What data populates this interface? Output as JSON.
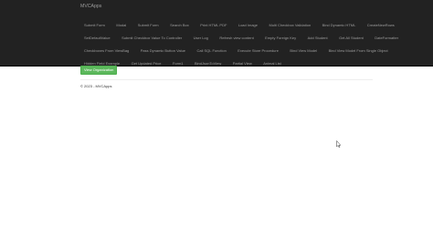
{
  "navbar": {
    "brand": "MVCApps",
    "rows": [
      [
        "Submit Form",
        "Modal",
        "Submit Form",
        "Search Box",
        "Print HTML PDF",
        "Load Image",
        "Multi Checkbox Validation",
        "Bind Dynamic HTML",
        "CreateNewRows"
      ],
      [
        "SetDefaultValue",
        "Submit Checkbox Value To Controller",
        "User Log",
        "Refresh view content",
        "Empty Foreign Key",
        "Add Student",
        "Get All Student",
        "DateFormatter"
      ],
      [
        "Checkboxes From ViewBag",
        "Pass Dynamic Button Value",
        "Call SQL Function",
        "Execute Store Procedure",
        "Bind View Model",
        "Bind View Model From Single Object"
      ],
      [
        "Hidden Field Example",
        "Get Updated Price",
        "Form1",
        "BindJsonToView",
        "Partial View",
        "Animal List"
      ]
    ]
  },
  "main": {
    "new_org_label": "View Organization"
  },
  "footer": {
    "text": "© 2023 - MVCApps"
  },
  "colors": {
    "navbar_bg": "#222222",
    "nav_link": "#9d9d9d",
    "button_bg": "#5cb85c"
  },
  "icons": {
    "cursor": "arrow-cursor-icon"
  }
}
